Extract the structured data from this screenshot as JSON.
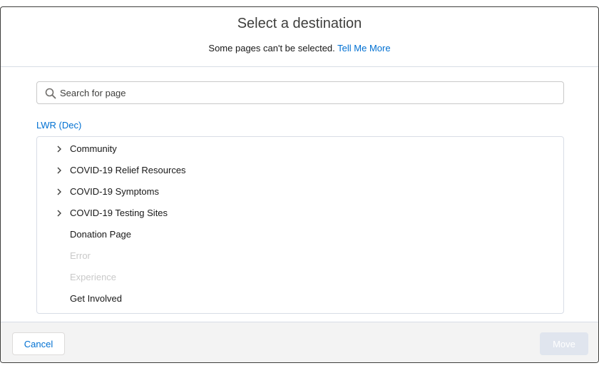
{
  "modal": {
    "title": "Select a destination",
    "subtitle_text": "Some pages can't be selected.",
    "subtitle_link": "Tell Me More"
  },
  "search": {
    "placeholder": "Search for page",
    "value": ""
  },
  "site_label": "LWR (Dec)",
  "tree": {
    "items": [
      {
        "label": "Community",
        "expandable": true,
        "disabled": false
      },
      {
        "label": "COVID-19 Relief Resources",
        "expandable": true,
        "disabled": false
      },
      {
        "label": "COVID-19 Symptoms",
        "expandable": true,
        "disabled": false
      },
      {
        "label": "COVID-19 Testing Sites",
        "expandable": true,
        "disabled": false
      },
      {
        "label": "Donation Page",
        "expandable": false,
        "disabled": false
      },
      {
        "label": "Error",
        "expandable": false,
        "disabled": true
      },
      {
        "label": "Experience",
        "expandable": false,
        "disabled": true
      },
      {
        "label": "Get Involved",
        "expandable": false,
        "disabled": false
      }
    ]
  },
  "footer": {
    "cancel_label": "Cancel",
    "move_label": "Move"
  },
  "icons": {
    "search": "search-icon",
    "chevron": "chevron-right-icon"
  },
  "colors": {
    "link": "#0070d2",
    "disabled_text": "#c9c9c9",
    "disabled_button": "#e0e5ee",
    "footer_bg": "#f3f3f3"
  }
}
